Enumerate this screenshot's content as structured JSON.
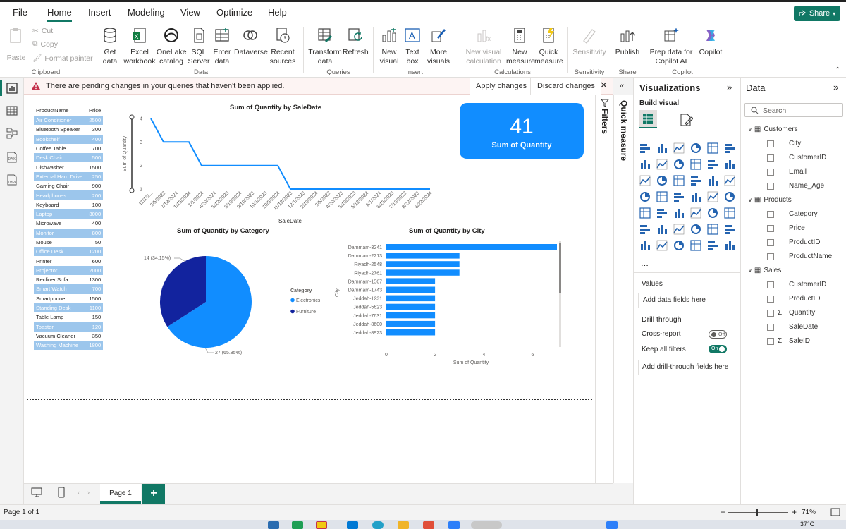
{
  "menu": {
    "items": [
      "File",
      "Home",
      "Insert",
      "Modeling",
      "View",
      "Optimize",
      "Help"
    ],
    "share": "Share"
  },
  "ribbon": {
    "clipboard": {
      "paste": "Paste",
      "cut": "Cut",
      "copy": "Copy",
      "format_painter": "Format painter",
      "group": "Clipboard"
    },
    "data": {
      "get_data": "Get data",
      "excel": "Excel workbook",
      "onelake": "OneLake catalog",
      "sql": "SQL Server",
      "enter": "Enter data",
      "dataverse": "Dataverse",
      "recent": "Recent sources",
      "group": "Data"
    },
    "queries": {
      "transform": "Transform data",
      "refresh": "Refresh",
      "group": "Queries"
    },
    "insert": {
      "new_visual": "New visual",
      "text_box": "Text box",
      "more_visuals": "More visuals",
      "group": "Insert"
    },
    "calculations": {
      "new_visual_calc": "New visual calculation",
      "new_measure": "New measure",
      "quick_measure": "Quick measure",
      "group": "Calculations"
    },
    "sensitivity": {
      "label": "Sensitivity",
      "group": "Sensitivity"
    },
    "share": {
      "publish": "Publish",
      "group": "Share"
    },
    "copilot": {
      "prep": "Prep data for Copilot AI",
      "copilot": "Copilot",
      "group": "Copilot"
    }
  },
  "warning": {
    "text": "There are pending changes in your queries that haven't been applied.",
    "apply": "Apply changes",
    "discard": "Discard changes"
  },
  "table": {
    "headers": [
      "ProductName",
      "Price"
    ],
    "rows": [
      {
        "name": "Air Conditioner",
        "price": "2500",
        "hl": true
      },
      {
        "name": "Bluetooth Speaker",
        "price": "300",
        "hl": false
      },
      {
        "name": "Bookshelf",
        "price": "400",
        "hl": true
      },
      {
        "name": "Coffee Table",
        "price": "700",
        "hl": false
      },
      {
        "name": "Desk Chair",
        "price": "500",
        "hl": true
      },
      {
        "name": "Dishwasher",
        "price": "1500",
        "hl": false
      },
      {
        "name": "External Hard Drive",
        "price": "250",
        "hl": true
      },
      {
        "name": "Gaming Chair",
        "price": "900",
        "hl": false
      },
      {
        "name": "Headphones",
        "price": "200",
        "hl": true
      },
      {
        "name": "Keyboard",
        "price": "100",
        "hl": false
      },
      {
        "name": "Laptop",
        "price": "3000",
        "hl": true
      },
      {
        "name": "Microwave",
        "price": "400",
        "hl": false
      },
      {
        "name": "Monitor",
        "price": "800",
        "hl": true
      },
      {
        "name": "Mouse",
        "price": "50",
        "hl": false
      },
      {
        "name": "Office Desk",
        "price": "1200",
        "hl": true
      },
      {
        "name": "Printer",
        "price": "600",
        "hl": false
      },
      {
        "name": "Projector",
        "price": "2000",
        "hl": true
      },
      {
        "name": "Recliner Sofa",
        "price": "1300",
        "hl": false
      },
      {
        "name": "Smart Watch",
        "price": "700",
        "hl": true
      },
      {
        "name": "Smartphone",
        "price": "1500",
        "hl": false
      },
      {
        "name": "Standing Desk",
        "price": "1100",
        "hl": true
      },
      {
        "name": "Table Lamp",
        "price": "150",
        "hl": false
      },
      {
        "name": "Toaster",
        "price": "120",
        "hl": true
      },
      {
        "name": "Vacuum Cleaner",
        "price": "350",
        "hl": false
      },
      {
        "name": "Washing Machine",
        "price": "1800",
        "hl": true
      }
    ]
  },
  "card": {
    "value": "41",
    "label": "Sum of Quantity"
  },
  "chart_data": [
    {
      "type": "line",
      "title": "Sum of Quantity by SaleDate",
      "xlabel": "SaleDate",
      "ylabel": "Sum of Quantity",
      "ylim": [
        1,
        4
      ],
      "yticks": [
        "1",
        "2",
        "3",
        "4"
      ],
      "x": [
        "11/1/2...",
        "3/5/2023",
        "7/18/2024",
        "1/15/2024",
        "1/1/2024",
        "4/20/2024",
        "5/12/2023",
        "8/10/2024",
        "9/10/2023",
        "10/5/2023",
        "10/5/2024",
        "11/12/2023",
        "12/1/2023",
        "2/10/2024",
        "3/5/2023",
        "4/20/2023",
        "5/10/2023",
        "5/12/2024",
        "6/1/2024",
        "6/15/2023",
        "7/18/2023",
        "8/22/2023",
        "6/22/2024"
      ],
      "series": [
        {
          "values": [
            4,
            3,
            3,
            3,
            2,
            2,
            2,
            2,
            2,
            2,
            2,
            1,
            1,
            1,
            1,
            1,
            1,
            1,
            1,
            1,
            1,
            1,
            1
          ]
        }
      ],
      "color": "#118dff"
    },
    {
      "type": "pie",
      "title": "Sum of Quantity by Category",
      "legend_title": "Category",
      "categories": [
        "Electronics",
        "Furniture"
      ],
      "values": [
        27,
        14
      ],
      "labels": [
        "27 (65.85%)",
        "14 (34.15%)"
      ],
      "colors": [
        "#118dff",
        "#12239e"
      ]
    },
    {
      "type": "bar",
      "orientation": "horizontal",
      "title": "Sum of Quantity by City",
      "xlabel": "Sum of Quantity",
      "ylabel": "City",
      "xlim": [
        0,
        7
      ],
      "xticks": [
        "0",
        "2",
        "4",
        "6"
      ],
      "categories": [
        "Dammam-3241",
        "Dammam-2213",
        "Riyadh-2548",
        "Riyadh-2761",
        "Dammam-1567",
        "Dammam-1743",
        "Jeddah-1231",
        "Jeddah-5623",
        "Jeddah-7631",
        "Jeddah-8600",
        "Jeddah-8923"
      ],
      "values": [
        7,
        3,
        3,
        3,
        2,
        2,
        2,
        2,
        2,
        2,
        2
      ],
      "color": "#118dff"
    }
  ],
  "filters": {
    "label": "Filters"
  },
  "quick_measure": {
    "label": "Quick measure"
  },
  "viz": {
    "title": "Visualizations",
    "build": "Build visual",
    "more": "...",
    "values": "Values",
    "add_data": "Add data fields here",
    "drill": "Drill through",
    "cross": "Cross-report",
    "cross_state": "Off",
    "keep": "Keep all filters",
    "keep_state": "On",
    "add_drill": "Add drill-through fields here"
  },
  "data_pane": {
    "title": "Data",
    "search_placeholder": "Search",
    "tables": [
      {
        "name": "Customers",
        "fields": [
          {
            "name": "City",
            "sigma": false
          },
          {
            "name": "CustomerID",
            "sigma": false
          },
          {
            "name": "Email",
            "sigma": false
          },
          {
            "name": "Name_Age",
            "sigma": false
          }
        ]
      },
      {
        "name": "Products",
        "fields": [
          {
            "name": "Category",
            "sigma": false
          },
          {
            "name": "Price",
            "sigma": false
          },
          {
            "name": "ProductID",
            "sigma": false
          },
          {
            "name": "ProductName",
            "sigma": false
          }
        ]
      },
      {
        "name": "Sales",
        "fields": [
          {
            "name": "CustomerID",
            "sigma": false
          },
          {
            "name": "ProductID",
            "sigma": false
          },
          {
            "name": "Quantity",
            "sigma": true
          },
          {
            "name": "SaleDate",
            "sigma": false
          },
          {
            "name": "SaleID",
            "sigma": true
          }
        ]
      }
    ]
  },
  "pages": {
    "current": "Page 1",
    "add": "+"
  },
  "status": {
    "page": "Page 1 of 1",
    "zoom": "71%"
  },
  "taskbar": {
    "temp": "37°C"
  }
}
